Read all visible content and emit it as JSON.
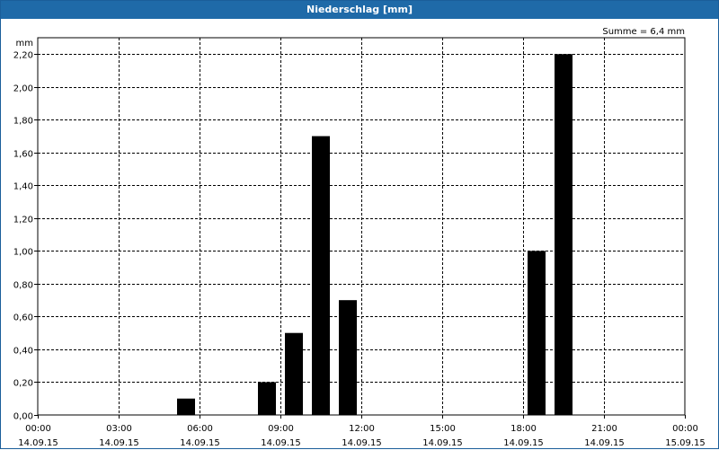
{
  "window": {
    "title": "Niederschlag [mm]"
  },
  "chart_data": {
    "type": "bar",
    "title": "Niederschlag [mm]",
    "ylabel": "mm",
    "annotation": "Summe = 6,4 mm",
    "xlim": [
      0,
      24
    ],
    "ylim": [
      0,
      2.3
    ],
    "y_ticks": [
      {
        "value": 0.0,
        "label": "0,00"
      },
      {
        "value": 0.2,
        "label": "0,20"
      },
      {
        "value": 0.4,
        "label": "0,40"
      },
      {
        "value": 0.6,
        "label": "0,60"
      },
      {
        "value": 0.8,
        "label": "0,80"
      },
      {
        "value": 1.0,
        "label": "1,00"
      },
      {
        "value": 1.2,
        "label": "1,20"
      },
      {
        "value": 1.4,
        "label": "1,40"
      },
      {
        "value": 1.6,
        "label": "1,60"
      },
      {
        "value": 1.8,
        "label": "1,80"
      },
      {
        "value": 2.0,
        "label": "2,00"
      },
      {
        "value": 2.2,
        "label": "2,20"
      }
    ],
    "x_ticks": [
      {
        "value": 0,
        "time": "00:00",
        "date": "14.09.15"
      },
      {
        "value": 3,
        "time": "03:00",
        "date": "14.09.15"
      },
      {
        "value": 6,
        "time": "06:00",
        "date": "14.09.15"
      },
      {
        "value": 9,
        "time": "09:00",
        "date": "14.09.15"
      },
      {
        "value": 12,
        "time": "12:00",
        "date": "14.09.15"
      },
      {
        "value": 15,
        "time": "15:00",
        "date": "14.09.15"
      },
      {
        "value": 18,
        "time": "18:00",
        "date": "14.09.15"
      },
      {
        "value": 21,
        "time": "21:00",
        "date": "14.09.15"
      },
      {
        "value": 24,
        "time": "00:00",
        "date": "15.09.15"
      }
    ],
    "bars": [
      {
        "hour": 5,
        "value": 0.1
      },
      {
        "hour": 8,
        "value": 0.2
      },
      {
        "hour": 9,
        "value": 0.5
      },
      {
        "hour": 10,
        "value": 1.7
      },
      {
        "hour": 11,
        "value": 0.7
      },
      {
        "hour": 18,
        "value": 1.0
      },
      {
        "hour": 19,
        "value": 2.2
      }
    ],
    "bar_color": "#000000",
    "grid": true,
    "grid_style": "dashed"
  }
}
